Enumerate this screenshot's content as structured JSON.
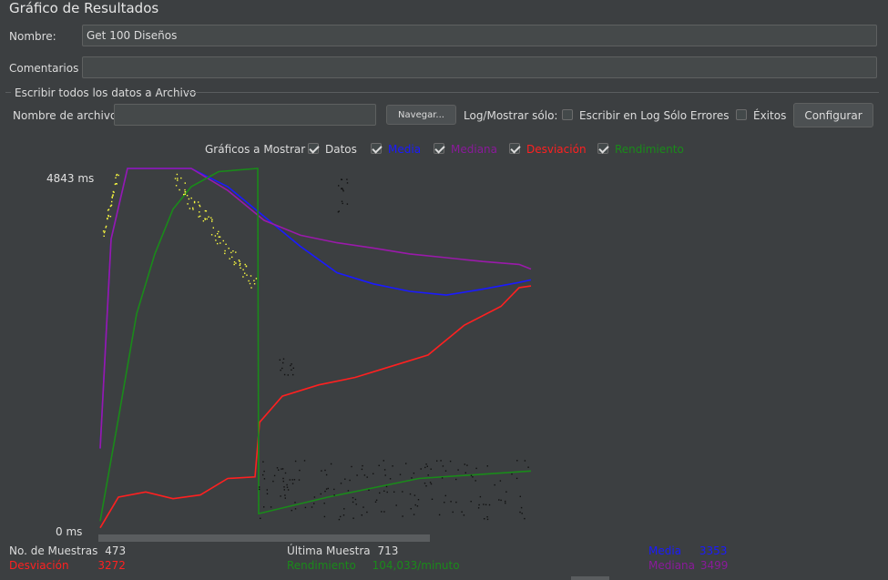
{
  "window": {
    "title": "Gráfico de Resultados"
  },
  "form": {
    "name_label": "Nombre:",
    "name_value": "Get 100 Diseños",
    "comments_label": "Comentarios",
    "comments_value": ""
  },
  "file_section": {
    "legend": "Escribir todos los datos a Archivo",
    "filename_label": "Nombre de archivo",
    "filename_value": "",
    "browse_button": "Navegar...",
    "log_label": "Log/Mostrar sólo:",
    "errors_only_label": "Escribir en Log Sólo Errores",
    "errors_only_checked": false,
    "successes_label": "Éxitos",
    "successes_checked": false,
    "configure_button": "Configurar"
  },
  "graphs_to_show": {
    "label": "Gráficos a Mostrar",
    "options": [
      {
        "label": "Datos",
        "color": "#dcdcdc",
        "checked": true
      },
      {
        "label": "Media",
        "color": "#1a1aff",
        "checked": true
      },
      {
        "label": "Mediana",
        "color": "#8a1a9a",
        "checked": true
      },
      {
        "label": "Desviación",
        "color": "#ff2020",
        "checked": true
      },
      {
        "label": "Rendimiento",
        "color": "#1a8a1a",
        "checked": true
      }
    ]
  },
  "chart_data": {
    "type": "line",
    "y_unit": "ms",
    "ylim": [
      0,
      4843
    ],
    "y_ticks": [
      "4843",
      "0"
    ],
    "x": "sample index (0–473)",
    "series": [
      {
        "name": "Media",
        "color": "#1a1aff",
        "values": [
          [
            0,
            1100
          ],
          [
            12,
            3900
          ],
          [
            30,
            4843
          ],
          [
            100,
            4843
          ],
          [
            140,
            4600
          ],
          [
            180,
            4200
          ],
          [
            220,
            3800
          ],
          [
            260,
            3450
          ],
          [
            300,
            3300
          ],
          [
            340,
            3200
          ],
          [
            380,
            3150
          ],
          [
            420,
            3230
          ],
          [
            460,
            3320
          ],
          [
            473,
            3353
          ]
        ]
      },
      {
        "name": "Mediana",
        "color": "#9a1aaa",
        "values": [
          [
            0,
            1100
          ],
          [
            12,
            3900
          ],
          [
            30,
            4843
          ],
          [
            100,
            4843
          ],
          [
            140,
            4550
          ],
          [
            180,
            4150
          ],
          [
            220,
            3950
          ],
          [
            260,
            3850
          ],
          [
            300,
            3780
          ],
          [
            340,
            3700
          ],
          [
            380,
            3650
          ],
          [
            420,
            3600
          ],
          [
            460,
            3560
          ],
          [
            473,
            3499
          ]
        ]
      },
      {
        "name": "Desviación",
        "color": "#ff2020",
        "values": [
          [
            0,
            40
          ],
          [
            20,
            450
          ],
          [
            50,
            520
          ],
          [
            80,
            430
          ],
          [
            110,
            480
          ],
          [
            140,
            700
          ],
          [
            170,
            720
          ],
          [
            175,
            1450
          ],
          [
            200,
            1800
          ],
          [
            240,
            1950
          ],
          [
            280,
            2050
          ],
          [
            320,
            2200
          ],
          [
            360,
            2350
          ],
          [
            400,
            2750
          ],
          [
            440,
            3000
          ],
          [
            460,
            3250
          ],
          [
            473,
            3272
          ]
        ]
      },
      {
        "name": "Rendimiento",
        "color": "#1a8a1a",
        "values": [
          [
            0,
            130
          ],
          [
            20,
            1500
          ],
          [
            40,
            2900
          ],
          [
            60,
            3700
          ],
          [
            80,
            4300
          ],
          [
            100,
            4600
          ],
          [
            130,
            4800
          ],
          [
            173,
            4843
          ],
          [
            174,
            230
          ],
          [
            250,
            450
          ],
          [
            350,
            700
          ],
          [
            473,
            800
          ]
        ]
      }
    ]
  },
  "stats": {
    "samples_label": "No. de Muestras",
    "samples_value": "473",
    "last_sample_label": "Última Muestra",
    "last_sample_value": "713",
    "mean_label": "Media",
    "mean_value": "3353",
    "deviation_label": "Desviación",
    "deviation_value": "3272",
    "throughput_label": "Rendimiento",
    "throughput_value": "104,033/minuto",
    "median_label": "Mediana",
    "median_value": "3499"
  }
}
